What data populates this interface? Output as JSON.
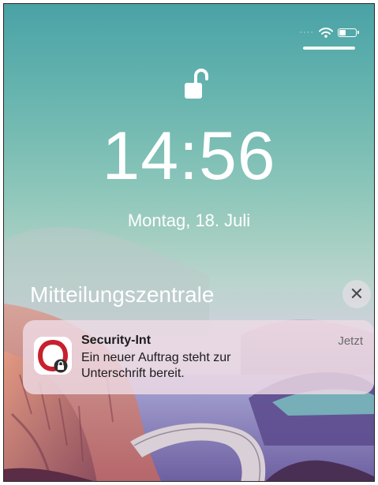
{
  "lock_screen": {
    "time": "14:56",
    "date": "Montag, 18. Juli",
    "lock_icon": "unlocked-padlock-icon",
    "status_bar": {
      "wifi_icon": "wifi-icon",
      "battery_icon": "battery-icon",
      "battery_level": 0.35
    }
  },
  "notification_center": {
    "title": "Mitteilungszentrale",
    "close_icon": "close-icon",
    "notifications": [
      {
        "app_name": "Security-Int",
        "timestamp": "Jetzt",
        "body_line_1": "Ein neuer Auftrag steht zur",
        "body_line_2": "Unterschrift bereit.",
        "app_icon": "security-int-app-icon",
        "brand_color": "#c8202e"
      }
    ]
  }
}
